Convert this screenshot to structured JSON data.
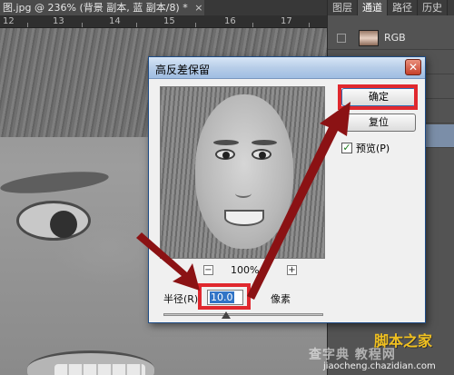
{
  "document": {
    "tab_title": "图.jpg @ 236% (背景 副本, 蓝 副本/8) *",
    "close_glyph": "×",
    "ruler_numbers": [
      "12",
      "13",
      "14",
      "15",
      "16",
      "17"
    ]
  },
  "panel": {
    "tabs": [
      "图层",
      "通道",
      "路径",
      "历史"
    ],
    "active_tab": "通道",
    "channel_label": "RGB"
  },
  "dialog": {
    "title": "高反差保留",
    "close_glyph": "✕",
    "ok_label": "确定",
    "reset_label": "复位",
    "preview_check_mark": "✓",
    "preview_label": "预览(P)",
    "zoom_minus": "−",
    "zoom_plus": "+",
    "zoom_value": "100%",
    "radius_label": "半径(R):",
    "radius_value": "10.0",
    "radius_unit": "像素"
  },
  "colors": {
    "highlight": "#e0282e",
    "arrow": "#8b1214",
    "title_gradient_start": "#d7e6f7",
    "close_button": "#c6412b"
  },
  "watermark": {
    "chinese": "脚本之家",
    "chazidian": "查字典 教程网",
    "url": "jiaocheng.chazidian.com"
  }
}
